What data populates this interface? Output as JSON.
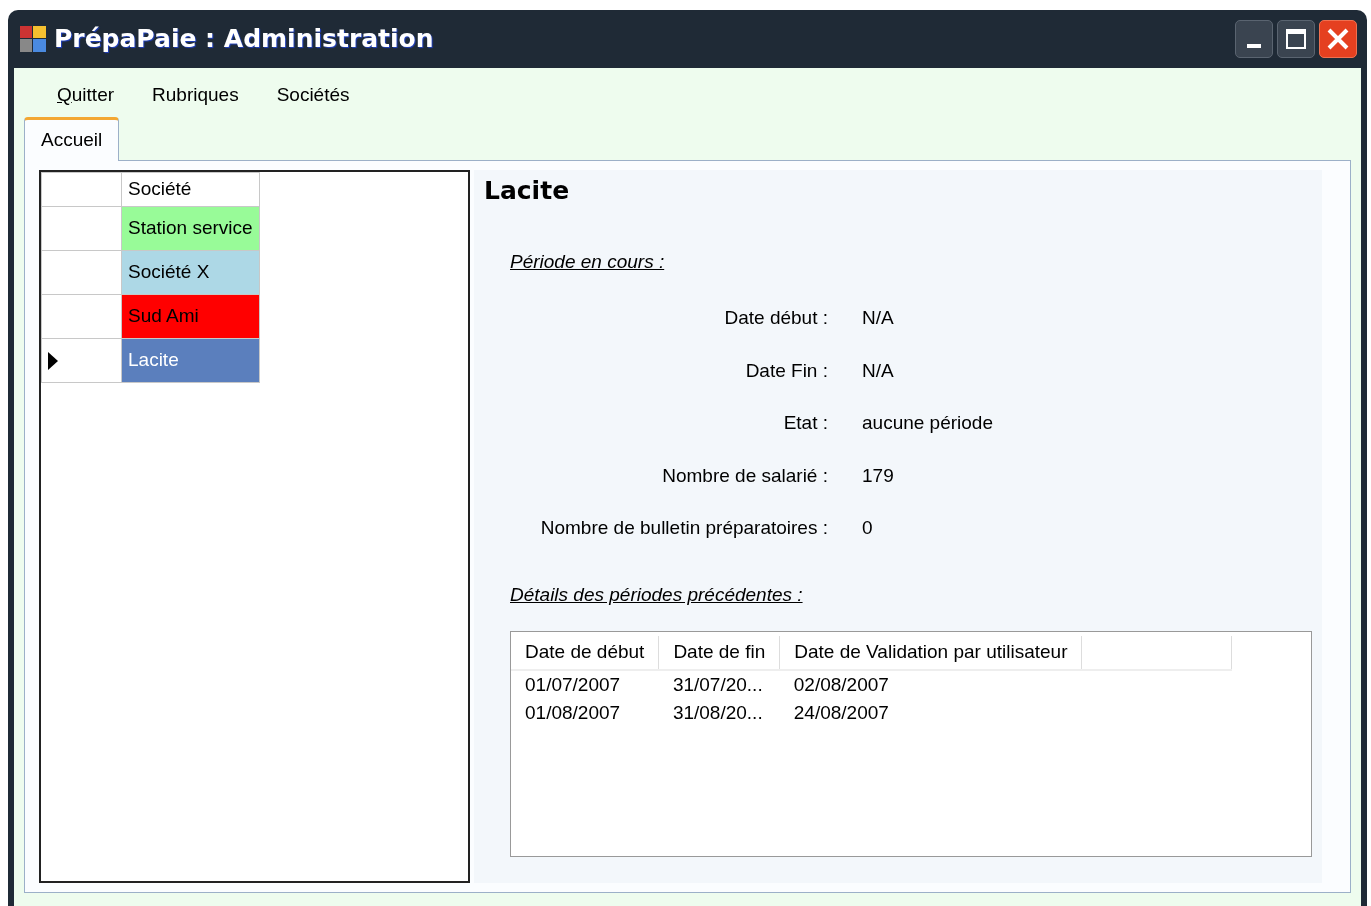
{
  "window": {
    "title": "PrépaPaie : Administration"
  },
  "menu": [
    {
      "label": "Quitter",
      "underline_first": true
    },
    {
      "label": "Rubriques"
    },
    {
      "label": "Sociétés"
    }
  ],
  "tabs": [
    {
      "label": "Accueil",
      "selected": true
    }
  ],
  "companies": {
    "column": "Société",
    "rows": [
      {
        "name": "Station service",
        "color": "#98fb98",
        "selected": false
      },
      {
        "name": "Société X",
        "color": "#add8e6",
        "selected": false
      },
      {
        "name": "Sud Ami",
        "color": "#ff0000",
        "selected": false
      },
      {
        "name": "Lacite",
        "color": "#5b7fbd",
        "selected": true
      }
    ]
  },
  "details": {
    "title": "Lacite",
    "current_heading": "Période en cours :",
    "fields": [
      {
        "label": "Date début :",
        "value": "N/A"
      },
      {
        "label": "Date Fin :",
        "value": "N/A"
      },
      {
        "label": "Etat :",
        "value": "aucune période"
      },
      {
        "label": "Nombre de salarié :",
        "value": "179"
      },
      {
        "label": "Nombre de bulletin préparatoires :",
        "value": "0"
      }
    ],
    "previous_heading": "Détails des périodes précédentes :",
    "table": {
      "columns": [
        "Date de début",
        "Date de fin",
        "Date de Validation par utilisateur"
      ],
      "rows": [
        [
          "01/07/2007",
          "31/07/20...",
          "02/08/2007"
        ],
        [
          "01/08/2007",
          "31/08/20...",
          "24/08/2007"
        ]
      ]
    }
  }
}
